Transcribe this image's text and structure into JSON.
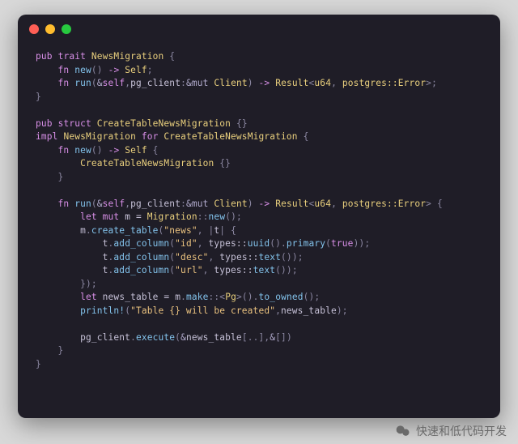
{
  "watermark": {
    "text": "快速和低代码开发"
  },
  "code": {
    "indent1": "    ",
    "indent2": "        ",
    "indent3": "            ",
    "kw_pub": "pub",
    "kw_trait": "trait",
    "kw_struct": "struct",
    "kw_impl": "impl",
    "kw_for": "for",
    "kw_fn": "fn",
    "kw_let": "let",
    "kw_mut": "mut",
    "arrow": "->",
    "trait_name": "NewsMigration",
    "struct_name": "CreateTableNewsMigration",
    "fn_new": "new",
    "fn_run": "run",
    "ty_Self": "Self",
    "ty_Client": "Client",
    "ty_Result": "Result",
    "ty_u64": "u64",
    "ty_postgres_Error": "postgres::Error",
    "ty_Migration": "Migration",
    "ty_Pg": "Pg",
    "var_self": "self",
    "param_pg_client": "pg_client",
    "var_m": "m",
    "var_t": "t",
    "var_news_table": "news_table",
    "call_new": "new",
    "call_create_table": "create_table",
    "call_add_column": "add_column",
    "call_make": "make",
    "call_to_owned": "to_owned",
    "call_execute": "execute",
    "call_uuid": "uuid",
    "call_primary": "primary",
    "call_text": "text",
    "macro_println": "println!",
    "types_path": "types::",
    "str_news": "\"news\"",
    "str_id": "\"id\"",
    "str_desc": "\"desc\"",
    "str_url": "\"url\"",
    "str_table_created": "\"Table {} will be created\"",
    "true": "true",
    "amp": "&",
    "amp_mut": "&mut",
    "colon": ":",
    "dcolon": "::",
    "lbrace": "{",
    "rbrace": "}",
    "lparen": "(",
    "rparen": ")",
    "lbracket": "[",
    "rbracket": "]",
    "lt": "<",
    "gt": ">",
    "comma": ", ",
    "semi": ";",
    "eq": " = ",
    "dot": ".",
    "pipe": "|",
    "range": "..",
    "sp": " "
  }
}
